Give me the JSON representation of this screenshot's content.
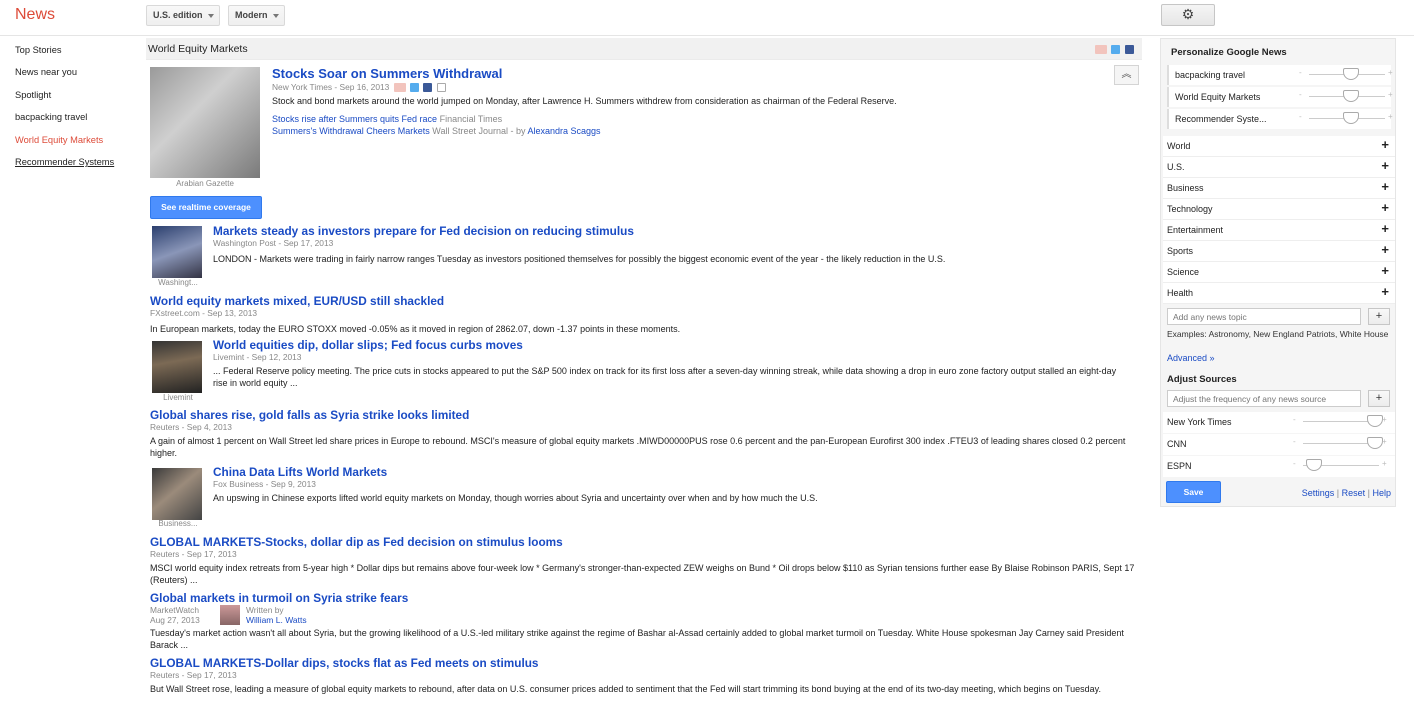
{
  "app": {
    "logo": "News"
  },
  "topbar": {
    "edition_label": "U.S. edition",
    "mode_label": "Modern",
    "settings_icon": "gear-icon"
  },
  "leftnav": {
    "items": [
      {
        "label": "Top Stories"
      },
      {
        "label": "News near you"
      },
      {
        "label": "Spotlight"
      },
      {
        "label": "bacpacking travel"
      },
      {
        "label": "World Equity Markets"
      },
      {
        "label": "Recommender Systems"
      }
    ]
  },
  "section": {
    "title": "World Equity Markets"
  },
  "lead": {
    "title": "Stocks Soar on Summers Withdrawal",
    "meta": "New York Times - Sep 16, 2013",
    "snippet": "Stock and bond markets around the world jumped on Monday, after Lawrence H. Summers withdrew from consideration as chairman of the Federal Reserve.",
    "related": [
      {
        "title": "Stocks rise after Summers quits Fed race",
        "source": "Financial Times"
      },
      {
        "title": "Summers's Withdrawal Cheers Markets",
        "source": "Wall Street Journal - by",
        "author": "Alexandra Scaggs"
      }
    ],
    "image_caption": "Arabian Gazette",
    "realtime_label": "See realtime coverage"
  },
  "stories": [
    {
      "title": "Markets steady as investors prepare for Fed decision on reducing stimulus",
      "meta": "Washington Post - Sep 17, 2013",
      "snippet": "LONDON - Markets were trading in fairly narrow ranges Tuesday as investors positioned themselves for possibly the biggest economic event of the year - the likely reduction in the U.S.",
      "thumb_caption": "Washingt..."
    },
    {
      "title": "World equity markets mixed, EUR/USD still shackled",
      "meta": "FXstreet.com - Sep 13, 2013",
      "snippet": "In European markets, today the EURO STOXX moved -0.05% as it moved in region of 2862.07, down -1.37 points in these moments."
    },
    {
      "title": "World equities dip, dollar slips; Fed focus curbs moves",
      "meta": "Livemint - Sep 12, 2013",
      "snippet": "... Federal Reserve policy meeting. The price cuts in stocks appeared to put the S&P 500 index on track for its first loss after a seven-day winning streak, while data showing a drop in euro zone factory output stalled an eight-day rise in world equity ...",
      "thumb_caption": "Livemint"
    },
    {
      "title": "Global shares rise, gold falls as Syria strike looks limited",
      "meta": "Reuters - Sep 4, 2013",
      "snippet": "A gain of almost 1 percent on Wall Street led share prices in Europe to rebound. MSCI's measure of global equity markets .MIWD00000PUS rose 0.6 percent and the pan-European Eurofirst 300 index .FTEU3 of leading shares closed 0.2 percent higher."
    },
    {
      "title": "China Data Lifts World Markets",
      "meta": "Fox Business - Sep 9, 2013",
      "snippet": "An upswing in Chinese exports lifted world equity markets on Monday, though worries about Syria and uncertainty over when and by how much the U.S.",
      "thumb_caption": "Business..."
    },
    {
      "title": "GLOBAL MARKETS-Stocks, dollar dip as Fed decision on stimulus looms",
      "meta": "Reuters - Sep 17, 2013",
      "snippet": "MSCI world equity index retreats from 5-year high * Dollar dips but remains above four-week low * Germany's stronger-than-expected ZEW weighs on Bund * Oil drops below $110 as Syrian tensions further ease By Blaise Robinson PARIS, Sept 17 (Reuters) ..."
    },
    {
      "title": "Global markets in turmoil on Syria strike fears",
      "meta_source": "MarketWatch",
      "meta_date": "Aug 27, 2013",
      "written_by": "Written by",
      "author": "William L. Watts",
      "snippet": "Tuesday's market action wasn't all about Syria, but the growing likelihood of a U.S.-led military strike against the regime of Bashar al-Assad certainly added to global market turmoil on Tuesday. White House spokesman Jay Carney said President Barack ..."
    },
    {
      "title": "GLOBAL MARKETS-Dollar dips, stocks flat as Fed meets on stimulus",
      "meta": "Reuters - Sep 17, 2013",
      "snippet": "But Wall Street rose, leading a measure of global equity markets to rebound, after data on U.S. consumer prices added to sentiment that the Fed will start trimming its bond buying at the end of its two-day meeting, which begins on Tuesday."
    }
  ],
  "right": {
    "personalize_title": "Personalize Google News",
    "custom_topics": [
      {
        "label": "bacpacking travel",
        "level": 0.55
      },
      {
        "label": "World Equity Markets",
        "level": 0.55
      },
      {
        "label": "Recommender Syste...",
        "level": 0.55
      }
    ],
    "topics": [
      "World",
      "U.S.",
      "Business",
      "Technology",
      "Entertainment",
      "Sports",
      "Science",
      "Health"
    ],
    "topic_plus": "+",
    "add_topic_placeholder": "Add any news topic",
    "examples": "Examples: Astronomy, New England Patriots, White House",
    "advanced": "Advanced »",
    "adjust_title": "Adjust Sources",
    "source_placeholder": "Adjust the frequency of any news source",
    "sources": [
      {
        "label": "New York Times",
        "level": 0.95
      },
      {
        "label": "CNN",
        "level": 0.95
      },
      {
        "label": "ESPN",
        "level": 0.15
      }
    ],
    "save_label": "Save",
    "settings_link": "Settings",
    "reset_link": "Reset",
    "help_link": "Help",
    "sep": "|"
  }
}
